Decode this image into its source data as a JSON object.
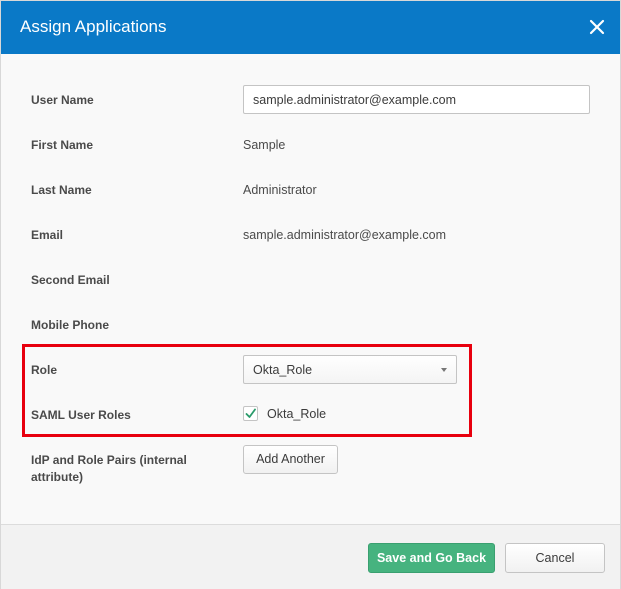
{
  "dialog": {
    "title": "Assign Applications",
    "close_icon": "close-icon"
  },
  "form": {
    "user_name": {
      "label": "User Name",
      "value": "sample.administrator@example.com"
    },
    "first_name": {
      "label": "First Name",
      "value": "Sample"
    },
    "last_name": {
      "label": "Last Name",
      "value": "Administrator"
    },
    "email": {
      "label": "Email",
      "value": "sample.administrator@example.com"
    },
    "second_email": {
      "label": "Second Email"
    },
    "mobile_phone": {
      "label": "Mobile Phone"
    },
    "role": {
      "label": "Role",
      "selected": "Okta_Role"
    },
    "saml_user_roles": {
      "label": "SAML User Roles",
      "option_label": "Okta_Role",
      "checked": true
    },
    "idp_role_pairs": {
      "label_line1": "IdP and Role Pairs (internal",
      "label_line2": "attribute)",
      "button_label": "Add Another"
    }
  },
  "footer": {
    "save_label": "Save and Go Back",
    "cancel_label": "Cancel"
  },
  "colors": {
    "header_bg": "#0a79c7",
    "save_button": "#46b37f",
    "highlight_border": "#e8000e",
    "checkmark": "#2a9b6b"
  }
}
